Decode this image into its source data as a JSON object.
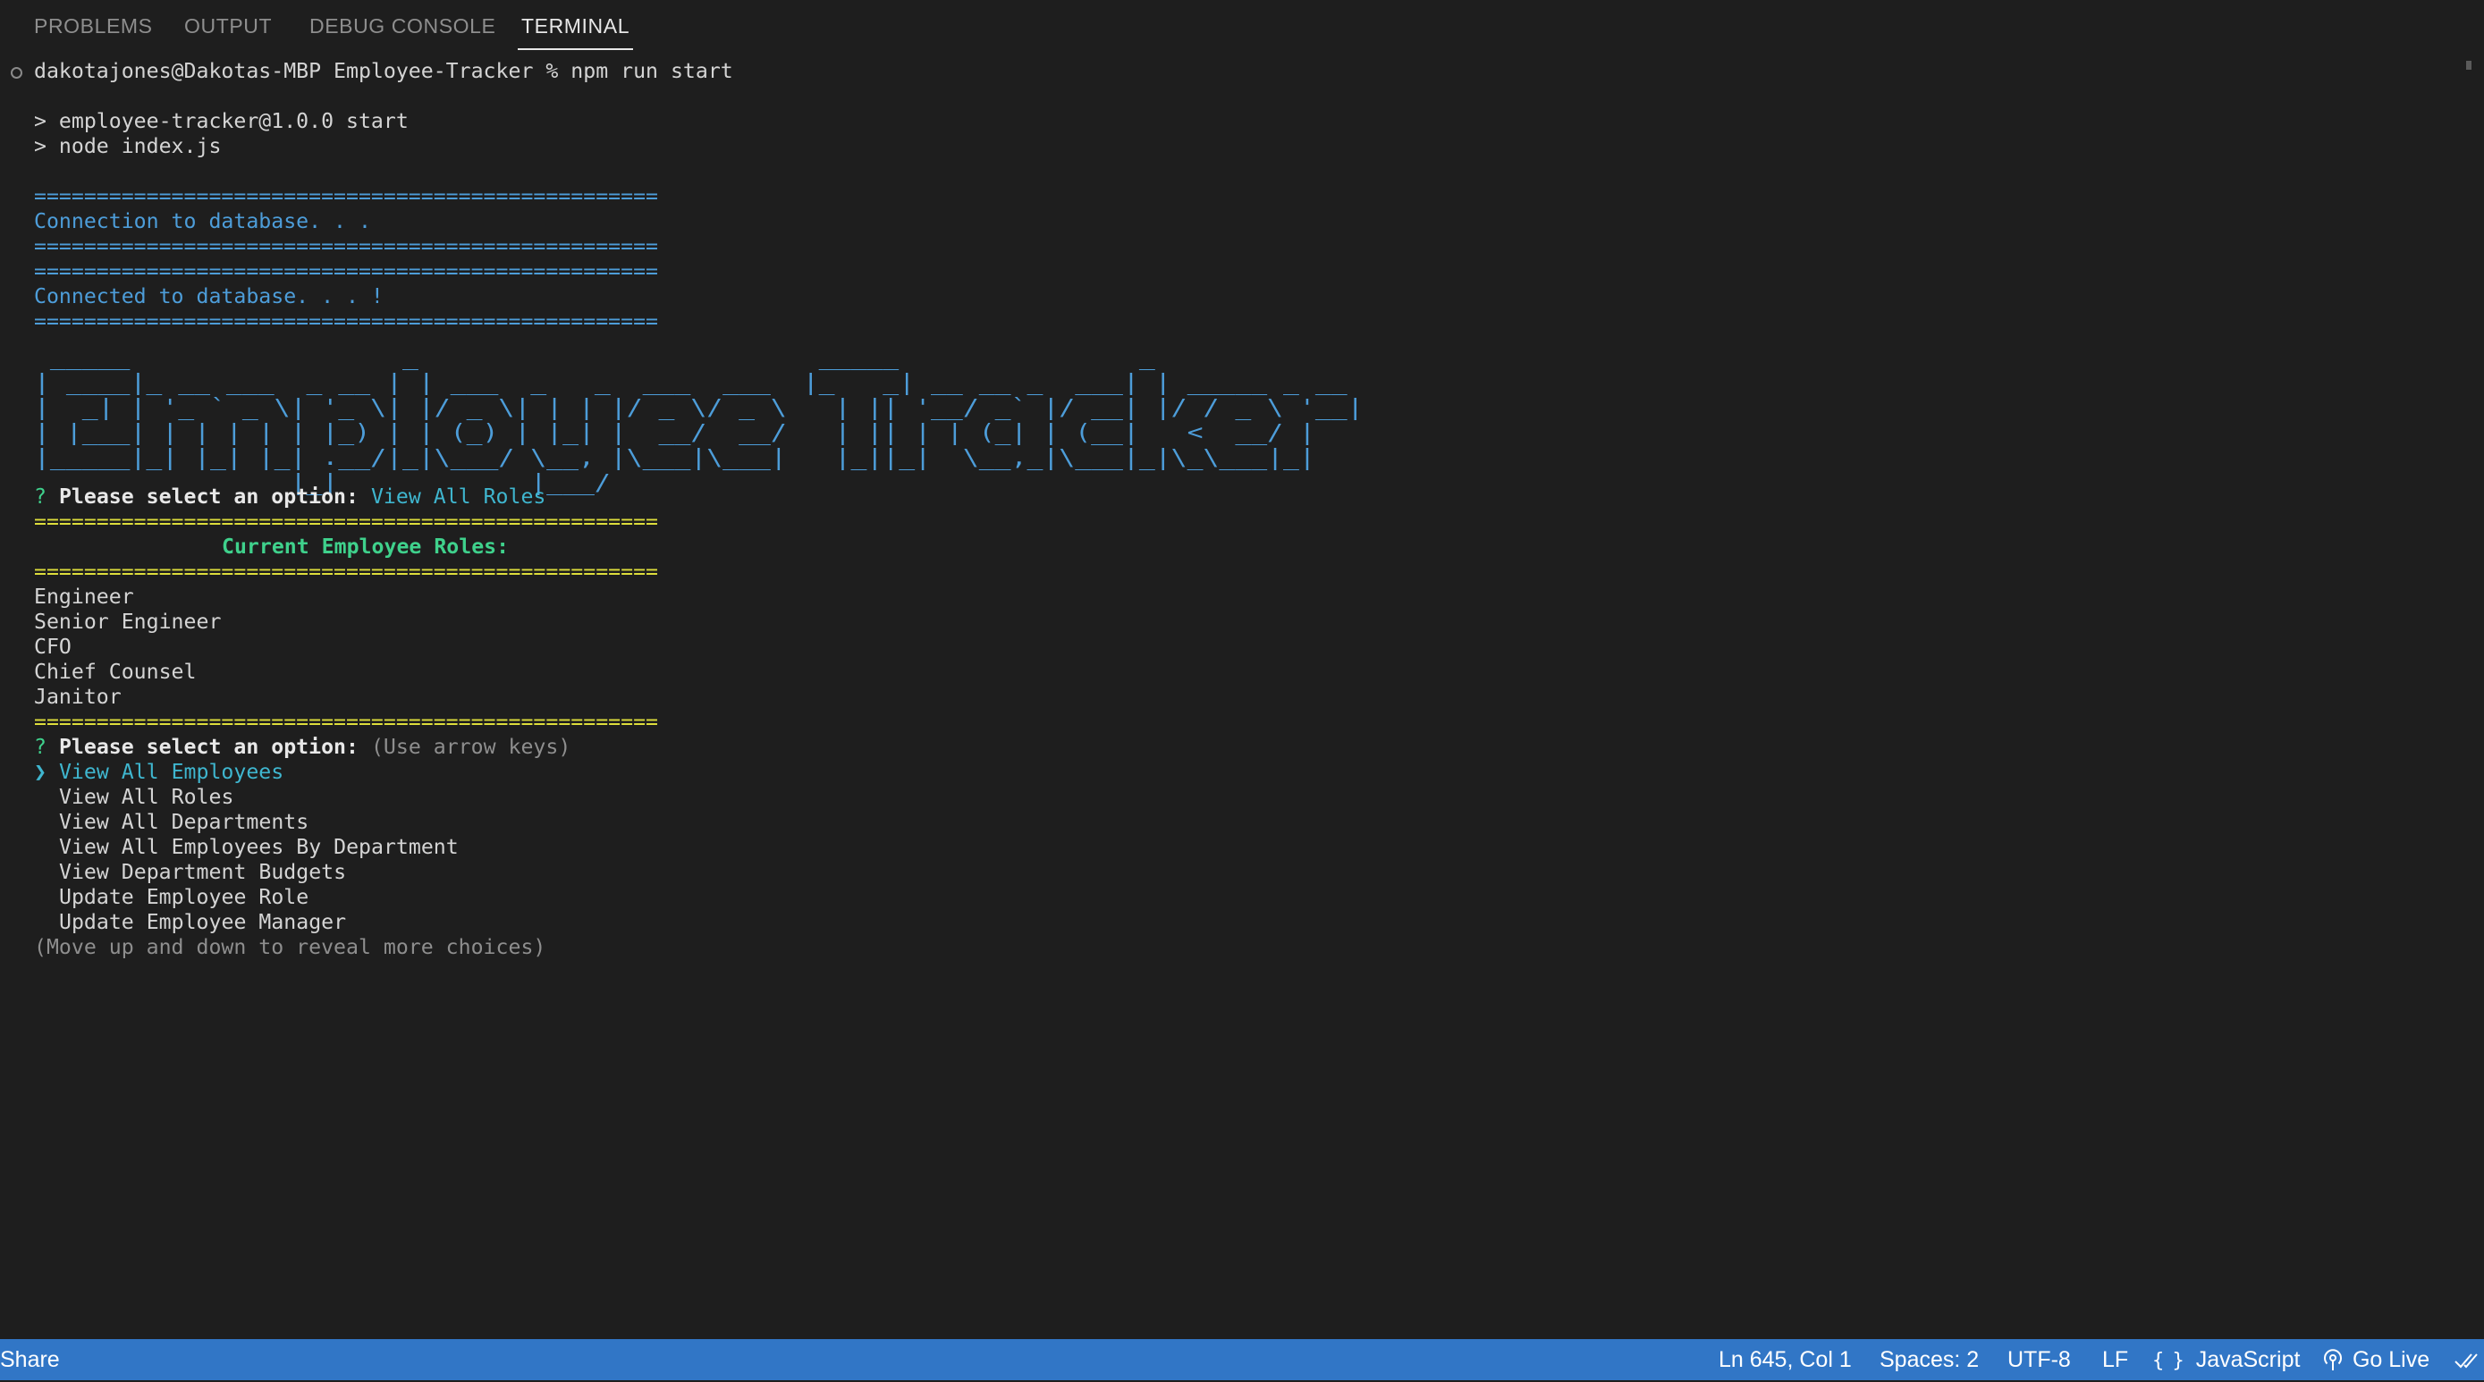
{
  "tabs": [
    {
      "label": "PROBLEMS"
    },
    {
      "label": "OUTPUT"
    },
    {
      "label": "DEBUG CONSOLE"
    },
    {
      "label": "TERMINAL"
    }
  ],
  "terminal": {
    "prompt_line": "dakotajones@Dakotas-MBP Employee-Tracker % npm run start",
    "npm_line1": "> employee-tracker@1.0.0 start",
    "npm_line2": "> node index.js",
    "blue_rule": "==================================================",
    "connecting": "Connection to database. . .",
    "connected": "Connected to database. . . !",
    "banner_art": " _____                 _                         _____               _\n| ____|_ __ ___  _ __ | | ___  _   _  ___  ___  |_   _| __ __ _  ___| | _____ _ __\n|  _| | '_ ` _ \\| '_ \\| |/ _ \\| | | |/ _ \\/ _ \\   | || '__/ _` |/ __| |/ / _ \\ '__|\n| |___| | | | | | |_) | | (_) | |_| |  __/  __/   | || | | (_| | (__|   <  __/ |\n|_____|_| |_| |_| .__/|_|\\___/ \\__, |\\___|\\___|   |_||_|  \\__,_|\\___|_|\\_\\___|_|\n                |_|            |___/",
    "q_mark": "?",
    "question": "Please select an option:",
    "answer1": "View All Roles",
    "yellow_rule": "==================================================",
    "roles_heading": "Current Employee Roles:",
    "roles": [
      "Engineer",
      "Senior Engineer",
      "CFO",
      "Chief Counsel",
      "Janitor"
    ],
    "hint": "(Use arrow keys)",
    "pointer": "❯",
    "options": [
      "View All Employees",
      "View All Roles",
      "View All Departments",
      "View All Employees By Department",
      "View Department Budgets",
      "Update Employee Role",
      "Update Employee Manager"
    ],
    "more_hint": "(Move up and down to reveal more choices)"
  },
  "statusbar": {
    "share": "Share",
    "position": "Ln 645, Col 1",
    "spaces": "Spaces: 2",
    "encoding": "UTF-8",
    "eol": "LF",
    "lang_icon": "{ }",
    "language": "JavaScript",
    "golive": "Go Live"
  },
  "colors": {
    "background": "#1e1e1e",
    "statusbar": "#3176c6",
    "blue_text": "#4d9dd9",
    "yellow_rule": "#dede3c",
    "green_heading": "#3fd18c",
    "cyan_answer": "#3fb6cf"
  },
  "icons": [
    "circle-icon",
    "broadcast-icon",
    "check-all-icon"
  ]
}
